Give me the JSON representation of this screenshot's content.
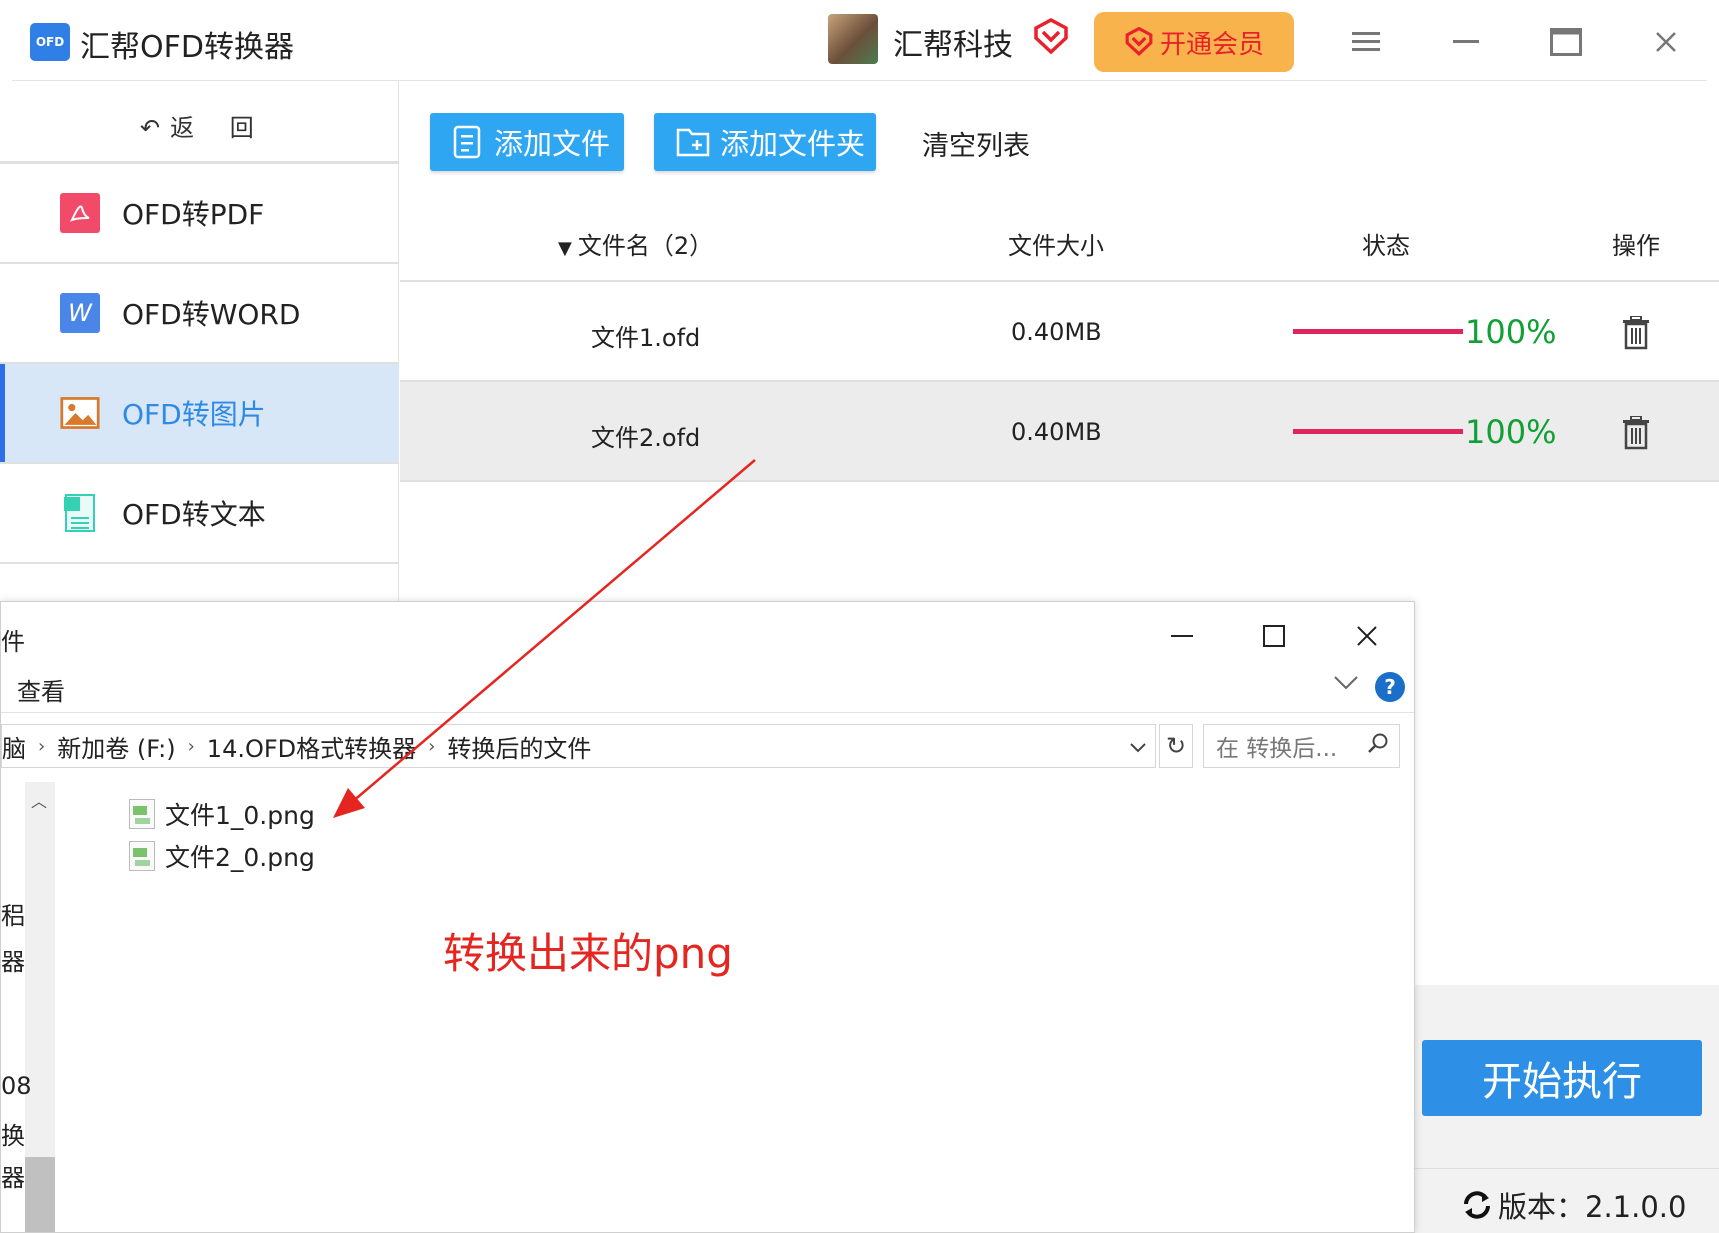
{
  "app": {
    "logo_text": "OFD",
    "title": "汇帮OFD转换器",
    "user_name": "汇帮科技",
    "vip_label": "开通会员"
  },
  "sidebar": {
    "back_label": "返 回",
    "items": [
      {
        "label": "OFD转PDF",
        "icon": "pdf-icon",
        "active": false
      },
      {
        "label": "OFD转WORD",
        "icon": "word-icon",
        "active": false
      },
      {
        "label": "OFD转图片",
        "icon": "image-icon",
        "active": true
      },
      {
        "label": "OFD转文本",
        "icon": "text-icon",
        "active": false
      }
    ]
  },
  "toolbar": {
    "add_file": "添加文件",
    "add_folder": "添加文件夹",
    "clear_list": "清空列表"
  },
  "table": {
    "headers": {
      "name": "文件名（2）",
      "size": "文件大小",
      "status": "状态",
      "action": "操作"
    },
    "rows": [
      {
        "name": "文件1.ofd",
        "size": "0.40MB",
        "progress_pct": 100,
        "status": "100%"
      },
      {
        "name": "文件2.ofd",
        "size": "0.40MB",
        "progress_pct": 100,
        "status": "100%"
      }
    ]
  },
  "footer": {
    "start_button": "开始执行",
    "version": "版本：2.1.0.0"
  },
  "explorer": {
    "title_fragment": "件",
    "ribbon_view": "查看",
    "breadcrumb": [
      "脑",
      "新加卷 (F:)",
      "14.OFD格式转换器",
      "转换后的文件"
    ],
    "search_placeholder": "在 转换后...",
    "nav_fragments": [
      "稆",
      "器",
      "08",
      "换",
      "器"
    ],
    "files": [
      "文件1_0.png",
      "文件2_0.png"
    ]
  },
  "annotation": {
    "text": "转换出来的png",
    "color": "#e52620"
  },
  "colors": {
    "accent_blue": "#2ea6f2",
    "active_bg": "#d7e7f8",
    "progress": "#e0245e",
    "status_green": "#11a035",
    "vip_orange": "#f9b34d"
  }
}
